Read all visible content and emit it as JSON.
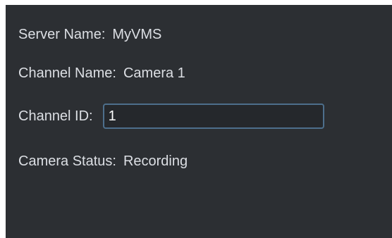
{
  "server": {
    "label": "Server Name:",
    "value": "MyVMS"
  },
  "channel": {
    "label": "Channel Name:",
    "value": "Camera 1"
  },
  "channel_id": {
    "label": "Channel ID:",
    "value": "1"
  },
  "camera_status": {
    "label": "Camera Status:",
    "value": "Recording"
  },
  "colors": {
    "panel_background": "#2c2f33",
    "text": "#dcdfe4",
    "input_border": "#4d6f8c"
  }
}
